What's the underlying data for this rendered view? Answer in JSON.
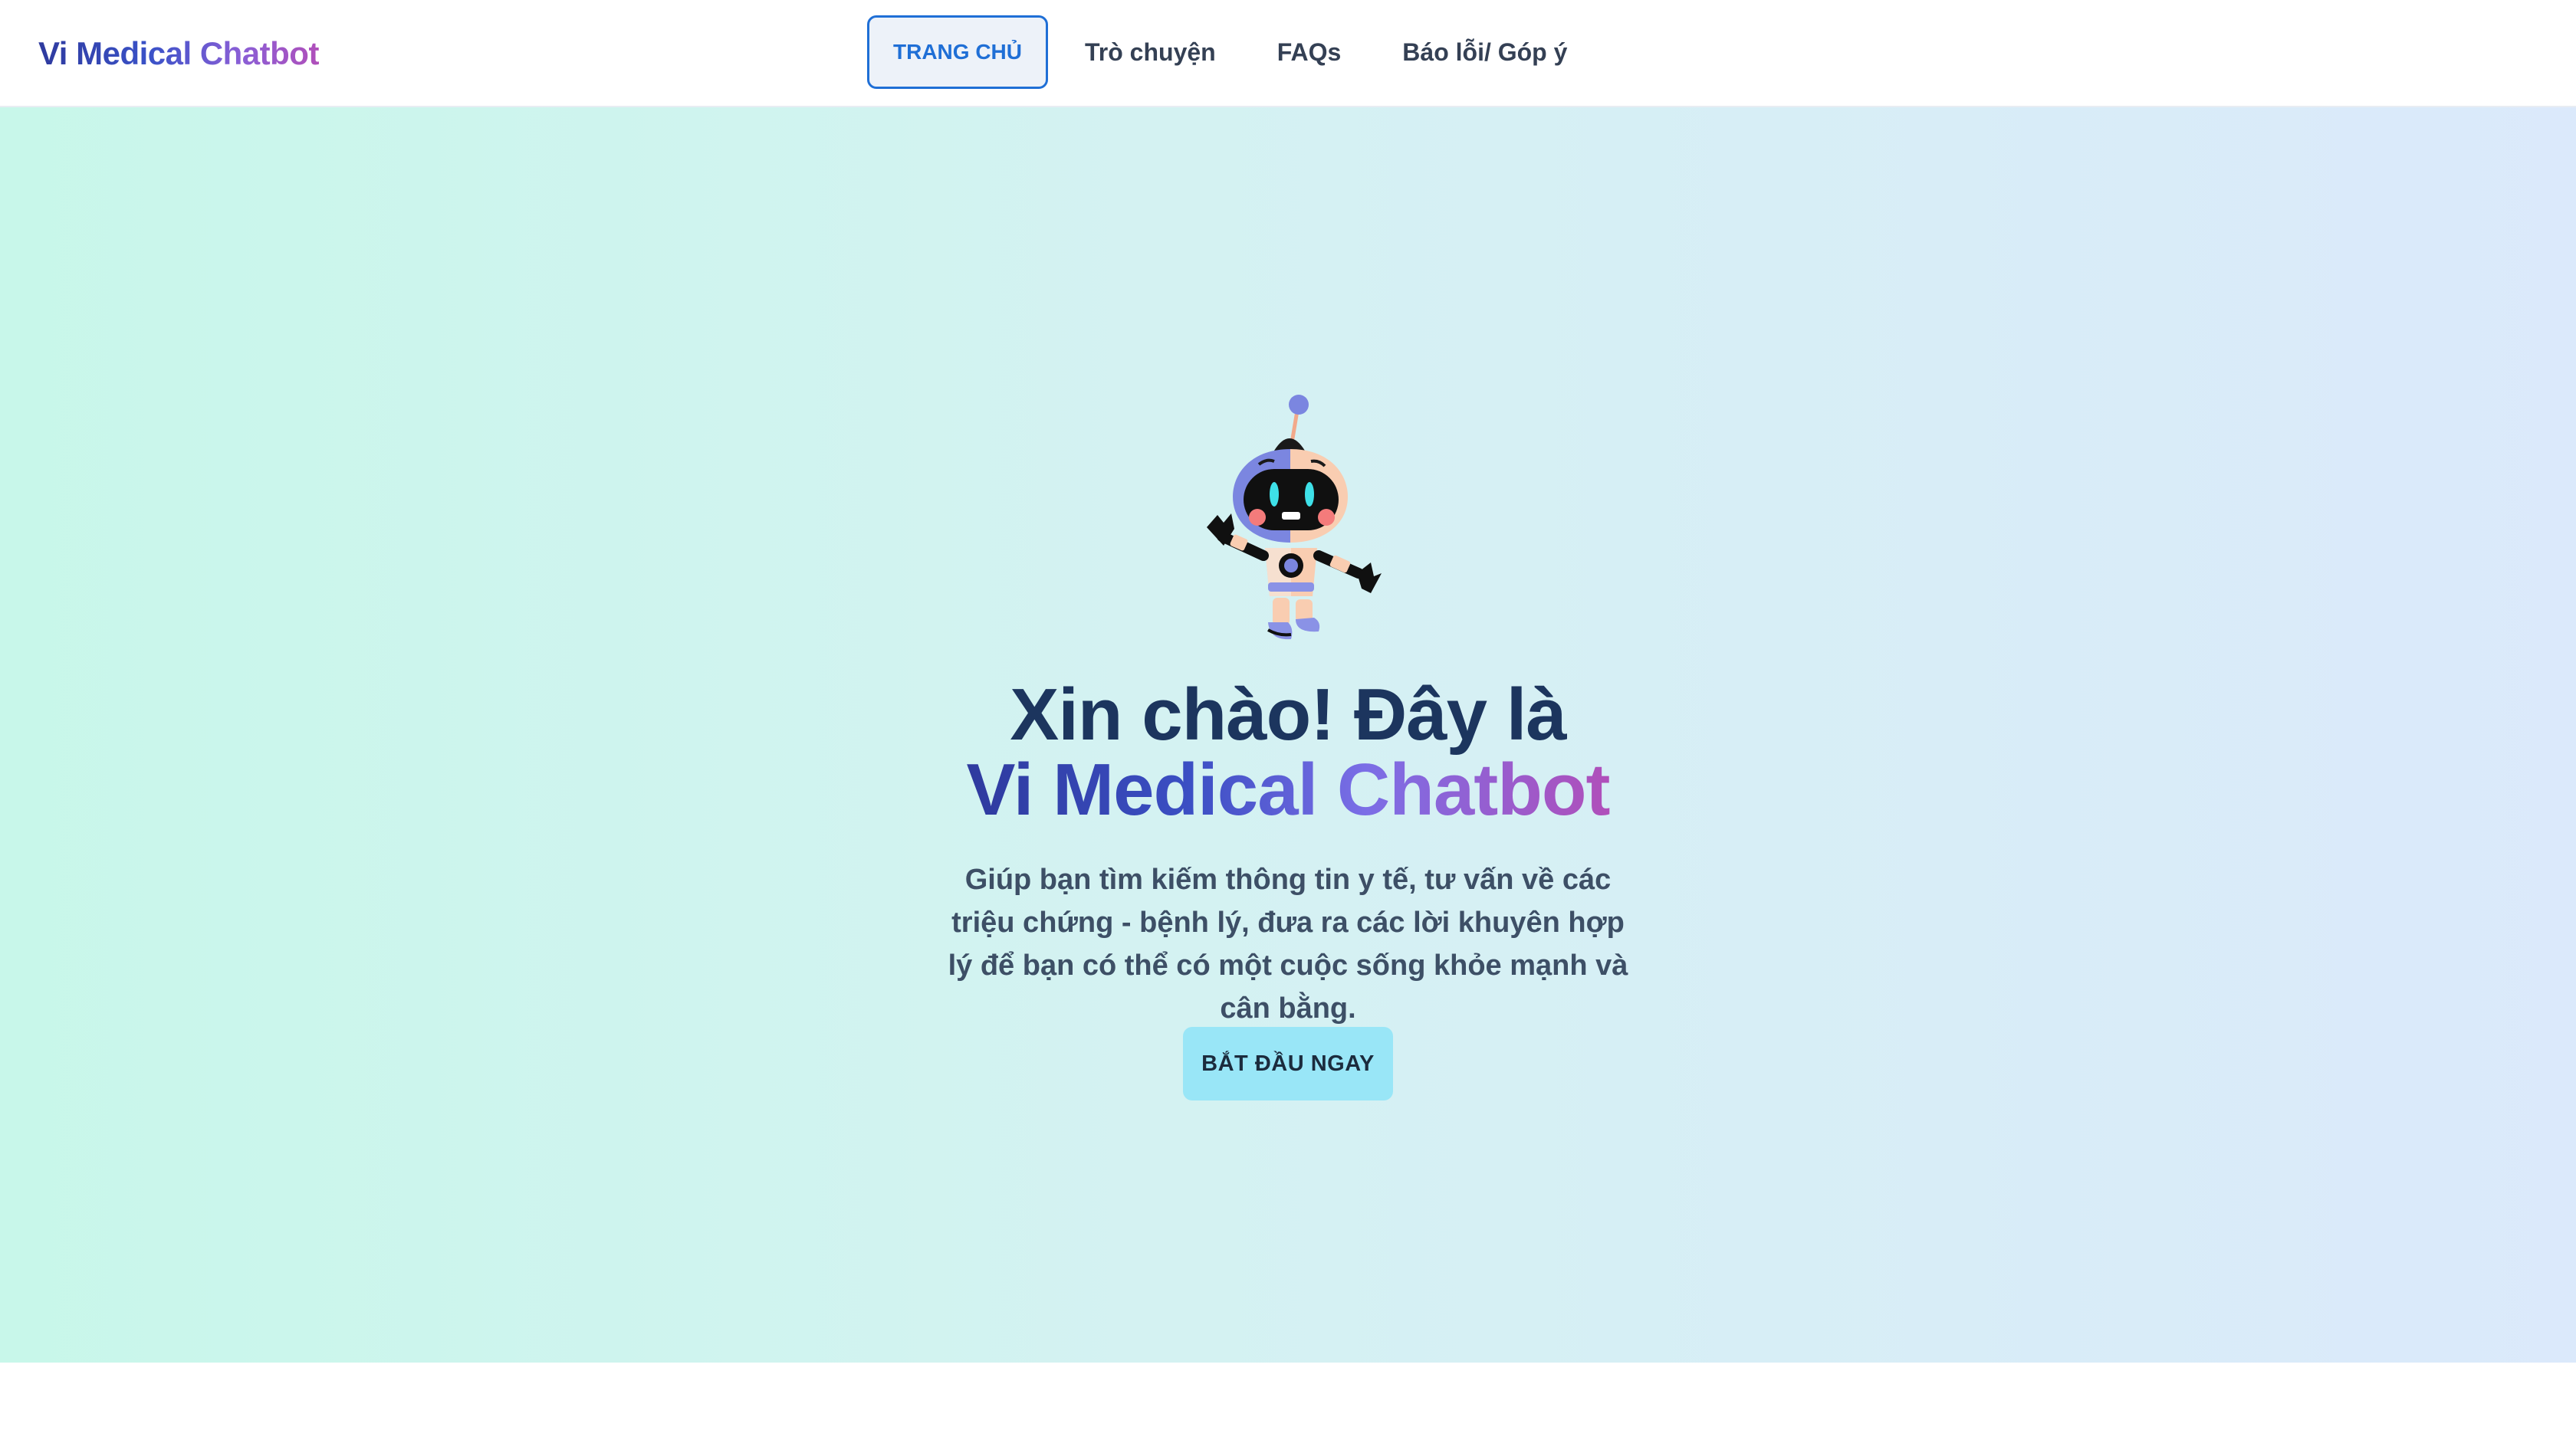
{
  "header": {
    "brand": "Vi Medical Chatbot",
    "nav": [
      {
        "label": "TRANG CHỦ",
        "active": true
      },
      {
        "label": "Trò chuyện",
        "active": false
      },
      {
        "label": "FAQs",
        "active": false
      },
      {
        "label": "Báo lỗi/ Góp ý",
        "active": false
      }
    ]
  },
  "hero": {
    "mascot_icon": "robot-mascot-icon",
    "headline_line1": "Xin chào! Đây là",
    "headline_line2": "Vi Medical Chatbot",
    "subtitle": "Giúp bạn tìm kiếm thông tin y tế, tư vấn về các triệu chứng - bệnh lý, đưa ra các lời khuyên hợp lý để bạn có thể có một cuộc sống khỏe mạnh và cân bằng.",
    "cta_label": "BẮT ĐẦU NGAY"
  },
  "colors": {
    "accent": "#1f6fd6",
    "cta_bg": "#99e6f7",
    "headline": "#1c355e"
  }
}
